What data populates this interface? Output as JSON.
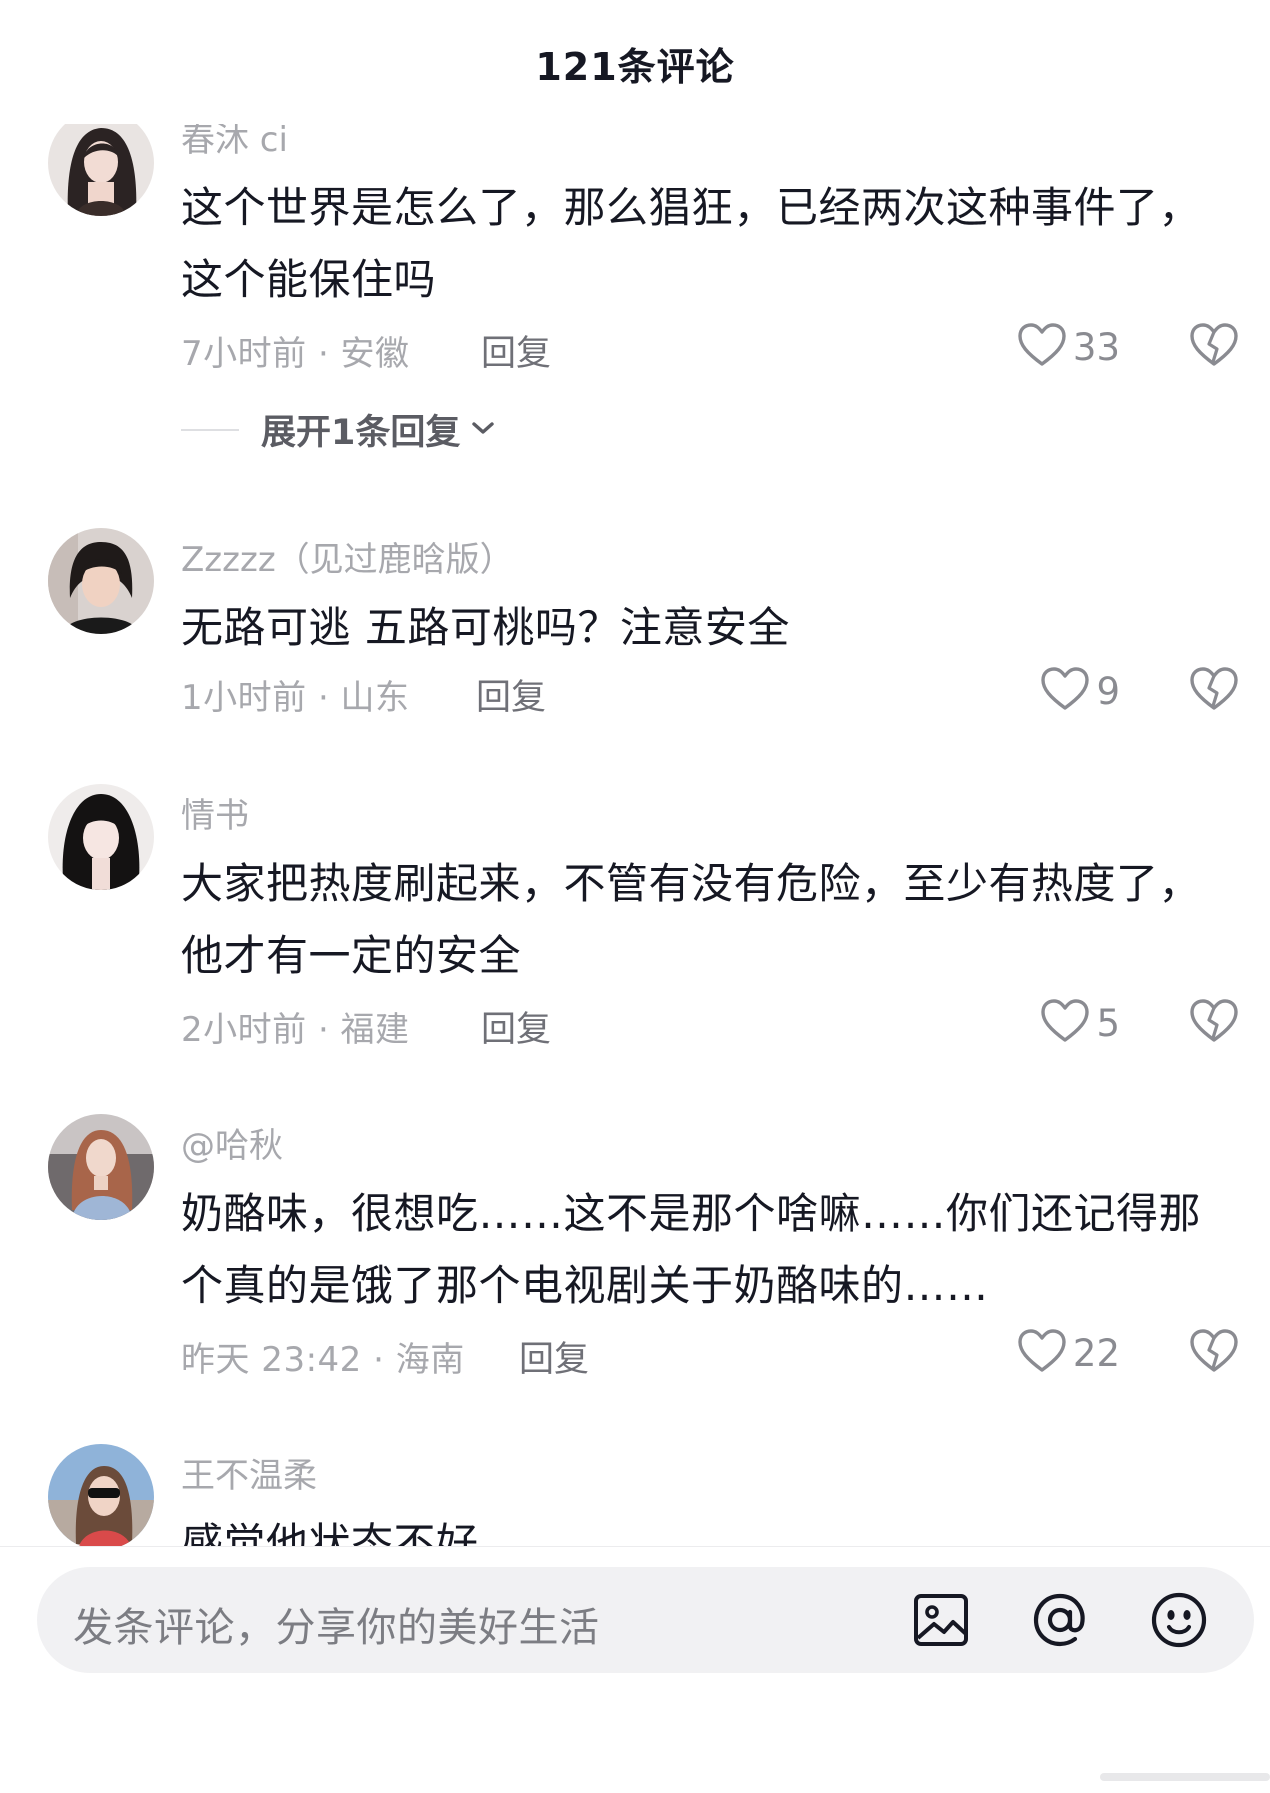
{
  "header": {
    "title": "121条评论"
  },
  "comments": [
    {
      "username": "春沐 ci",
      "text": "这个世界是怎么了，那么猖狂，已经两次这种事件了，这个能保住吗",
      "meta": "7小时前 · 安徽",
      "reply_label": "回复",
      "likes": "33",
      "expand_label": "展开1条回复"
    },
    {
      "username": "Zzzzz（见过鹿晗版）",
      "text": "无路可逃 五路可桃吗？注意安全",
      "meta": "1小时前 · 山东",
      "reply_label": "回复",
      "likes": "9"
    },
    {
      "username": "情书",
      "text": "大家把热度刷起来，不管有没有危险，至少有热度了，他才有一定的安全",
      "meta": "2小时前 · 福建",
      "reply_label": "回复",
      "likes": "5"
    },
    {
      "username": "@哈秋",
      "text": "奶酪味，很想吃……这不是那个啥嘛……你们还记得那个真的是饿了那个电视剧关于奶酪味的……",
      "meta": "昨天 23:42 · 海南",
      "reply_label": "回复",
      "likes": "22"
    },
    {
      "username": "王不温柔",
      "text": "感觉他状态不好"
    }
  ],
  "composer": {
    "placeholder": "发条评论，分享你的美好生活"
  },
  "icons": {
    "like": "heart-outline-icon",
    "dislike": "broken-heart-icon",
    "expand": "chevron-down-icon",
    "image": "image-icon",
    "mention": "at-sign-icon",
    "emoji": "smiley-icon"
  },
  "colors": {
    "text_primary": "#161823",
    "text_secondary": "#a7a8ad",
    "input_bg": "#f1f1f3"
  }
}
